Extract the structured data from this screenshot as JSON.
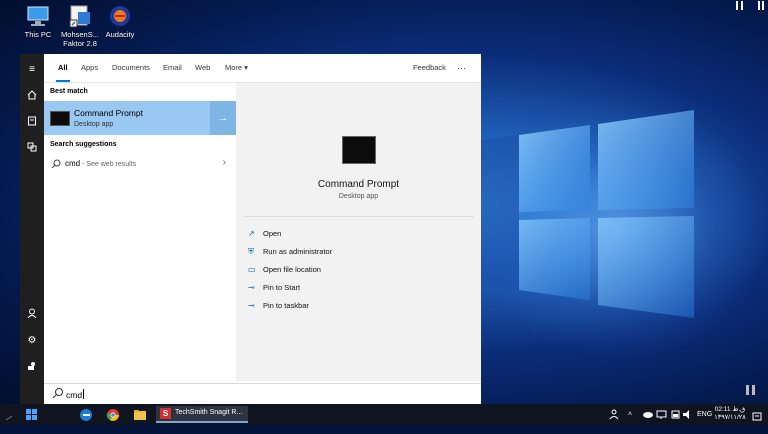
{
  "desktop": {
    "icons": [
      {
        "label": "This PC",
        "icon": "computer-icon"
      },
      {
        "label": "MohsenS... Faktor 2.8",
        "icon": "app-shortcut-icon"
      },
      {
        "label": "Audacity",
        "icon": "audacity-icon"
      }
    ]
  },
  "search": {
    "tabs": [
      {
        "label": "All",
        "active": true
      },
      {
        "label": "Apps"
      },
      {
        "label": "Documents"
      },
      {
        "label": "Email"
      },
      {
        "label": "Web"
      },
      {
        "label": "More ▾"
      }
    ],
    "feedback_label": "Feedback",
    "more_options": "···",
    "best_match_heading": "Best match",
    "best_match": {
      "title": "Command Prompt",
      "subtitle": "Desktop app"
    },
    "suggestions_heading": "Search suggestions",
    "suggestion": {
      "query": "cmd",
      "hint": " - See web results"
    },
    "preview": {
      "title": "Command Prompt",
      "subtitle": "Desktop app"
    },
    "actions": [
      {
        "label": "Open",
        "icon": "open-icon"
      },
      {
        "label": "Run as administrator",
        "icon": "admin-shield-icon"
      },
      {
        "label": "Open file location",
        "icon": "folder-location-icon"
      },
      {
        "label": "Pin to Start",
        "icon": "pin-icon"
      },
      {
        "label": "Pin to taskbar",
        "icon": "pin-icon"
      }
    ],
    "query": "cmd"
  },
  "taskbar": {
    "snagit_label": "TechSmith Snagit R...",
    "lang": "ENG",
    "time": "02:11 ق.ظ",
    "date": "۱۳۹۷/۱۱/۲۸"
  },
  "colors": {
    "accent": "#0078d7",
    "highlight": "#99c9f2"
  }
}
